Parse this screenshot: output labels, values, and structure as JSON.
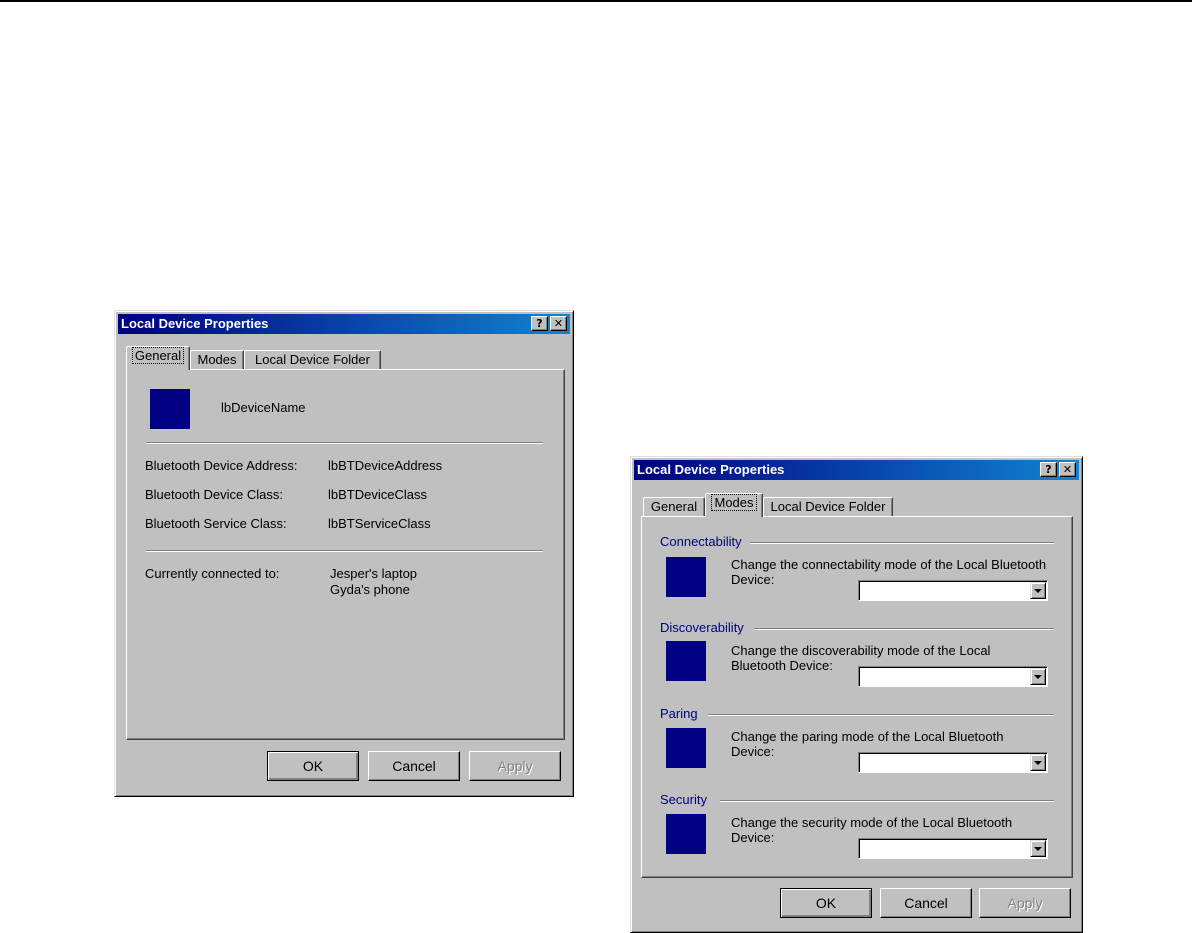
{
  "dialog_title": "Local Device Properties",
  "titlebar_buttons": {
    "help": "?",
    "close": "✕"
  },
  "tabs": {
    "general": "General",
    "modes": "Modes",
    "folder": "Local Device Folder"
  },
  "general_tab": {
    "device_name": "lbDeviceName",
    "rows": [
      {
        "label": "Bluetooth Device Address:",
        "value": "lbBTDeviceAddress"
      },
      {
        "label": "Bluetooth Device Class:",
        "value": "lbBTDeviceClass"
      },
      {
        "label": "Bluetooth Service Class:",
        "value": "lbBTServiceClass"
      }
    ],
    "connected_label": "Currently connected to:",
    "connected_devices": [
      "Jesper's laptop",
      "Gyda's phone"
    ]
  },
  "modes_tab": {
    "groups": [
      {
        "title": "Connectability",
        "line1": "Change the connectability mode of the Local Bluetooth",
        "line2": "Device:"
      },
      {
        "title": "Discoverability",
        "line1": "Change the discoverability mode of the Local",
        "line2": "Bluetooth Device:"
      },
      {
        "title": "Paring",
        "line1": "Change the paring mode of the Local Bluetooth",
        "line2": "Device:"
      },
      {
        "title": "Security",
        "line1": "Change the security mode of the Local Bluetooth",
        "line2": "Device:"
      }
    ]
  },
  "buttons": {
    "ok": "OK",
    "cancel": "Cancel",
    "apply": "Apply"
  },
  "colors": {
    "title_start": "#000080",
    "title_end": "#1084d0",
    "icon": "#000080",
    "face": "#c0c0c0"
  }
}
